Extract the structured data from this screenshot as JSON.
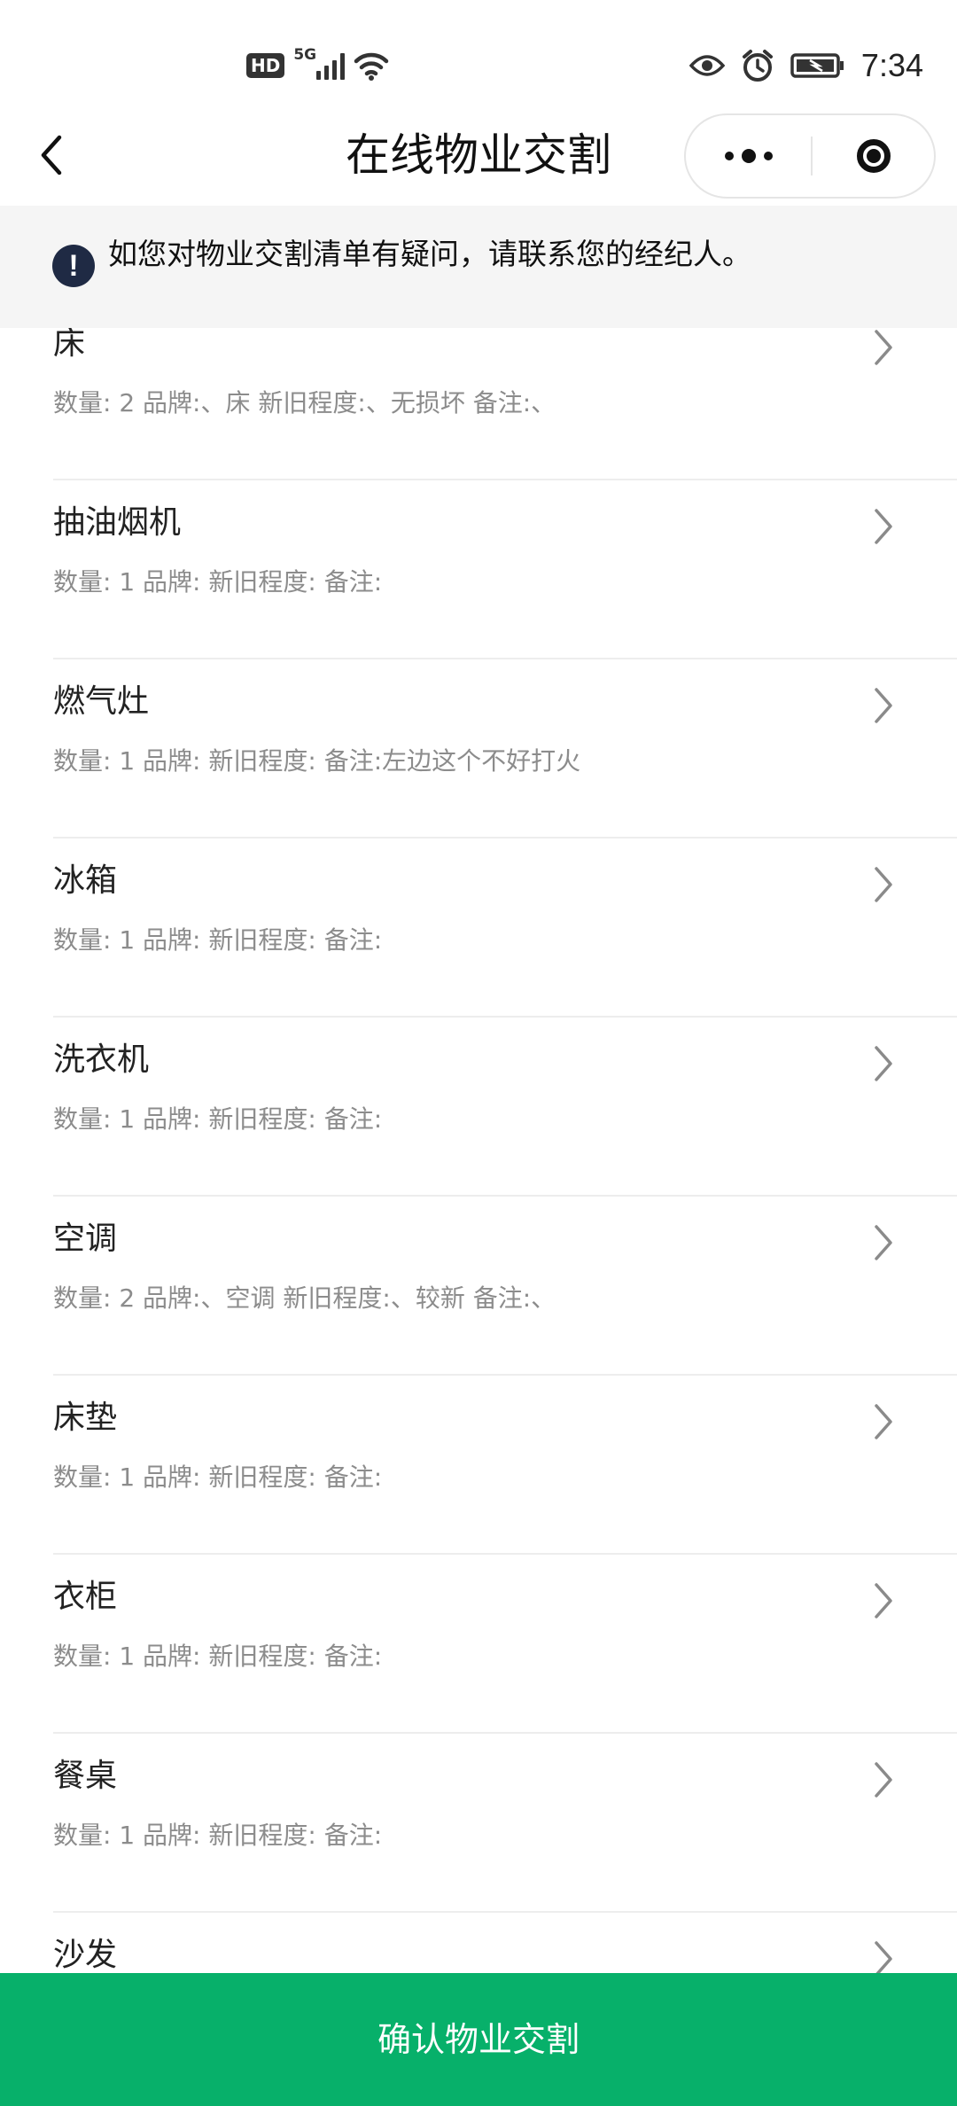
{
  "status_bar": {
    "hd": "HD",
    "network": "5G",
    "time": "7:34"
  },
  "nav": {
    "title": "在线物业交割"
  },
  "notice": {
    "icon": "!",
    "text": "如您对物业交割清单有疑问，请联系您的经纪人。"
  },
  "items": [
    {
      "name": "床",
      "detail": "数量: 2 品牌:、床 新旧程度:、无损坏 备注:、"
    },
    {
      "name": "抽油烟机",
      "detail": "数量: 1 品牌: 新旧程度: 备注:"
    },
    {
      "name": "燃气灶",
      "detail": "数量: 1 品牌: 新旧程度: 备注:左边这个不好打火"
    },
    {
      "name": "冰箱",
      "detail": "数量: 1 品牌: 新旧程度: 备注:"
    },
    {
      "name": "洗衣机",
      "detail": "数量: 1 品牌: 新旧程度: 备注:"
    },
    {
      "name": "空调",
      "detail": "数量: 2 品牌:、空调 新旧程度:、较新 备注:、"
    },
    {
      "name": "床垫",
      "detail": "数量: 1 品牌: 新旧程度: 备注:"
    },
    {
      "name": "衣柜",
      "detail": "数量: 1 品牌: 新旧程度: 备注:"
    },
    {
      "name": "餐桌",
      "detail": "数量: 1 品牌: 新旧程度: 备注:"
    },
    {
      "name": "沙发",
      "detail": ""
    }
  ],
  "confirm_button": {
    "label": "确认物业交割"
  },
  "colors": {
    "accent_green": "#07b06a",
    "notice_bg": "#f5f5f5",
    "notice_icon": "#1f2a44"
  }
}
